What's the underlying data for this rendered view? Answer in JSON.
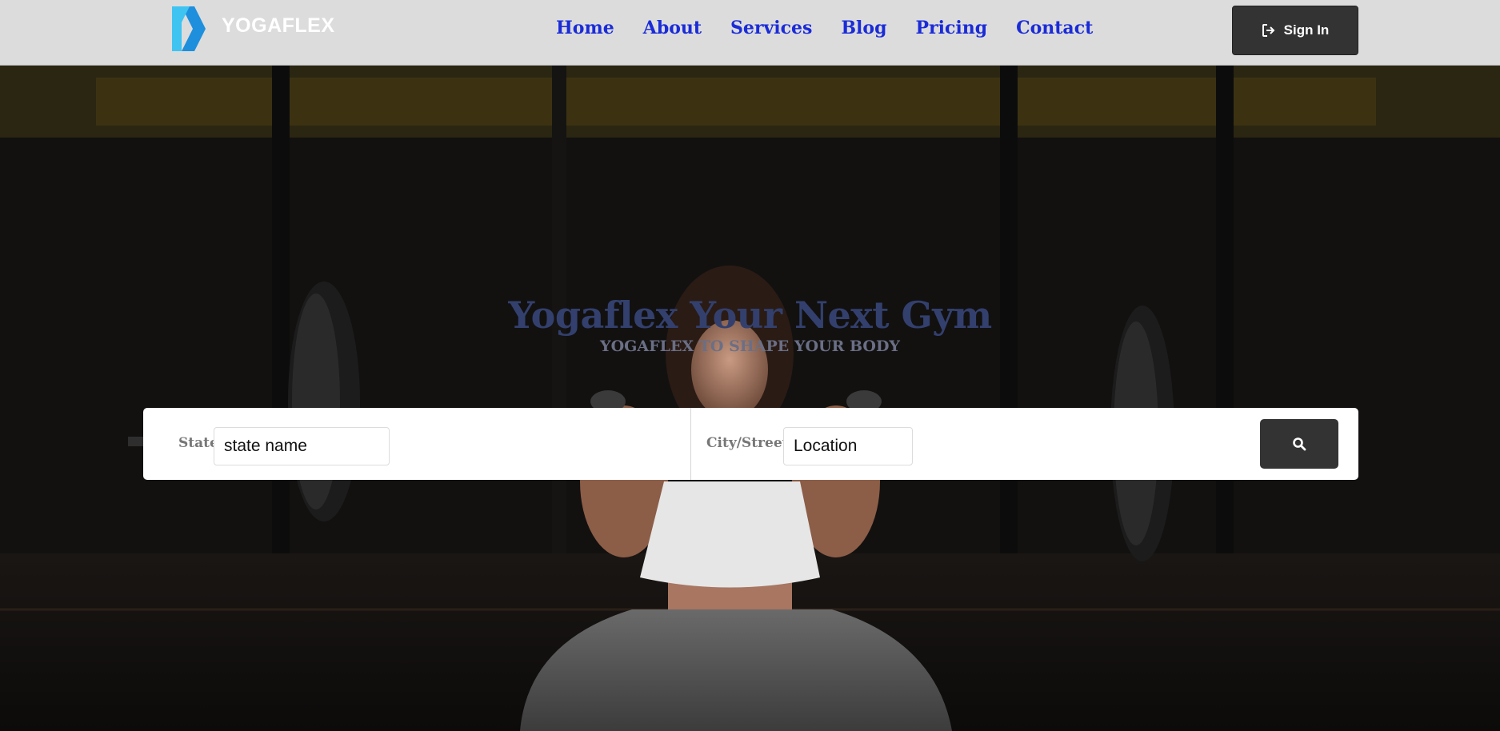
{
  "brand": {
    "name": "YOGAFLEX",
    "icon": "yogaflex-logo-icon",
    "colors": {
      "primary": "#3fc4f2",
      "secondary": "#1e8fdc"
    }
  },
  "nav": {
    "items": [
      {
        "label": "Home"
      },
      {
        "label": "About"
      },
      {
        "label": "Services"
      },
      {
        "label": "Blog"
      },
      {
        "label": "Pricing"
      },
      {
        "label": "Contact"
      }
    ],
    "link_color": "#1a2bd8"
  },
  "signin": {
    "label": "Sign In",
    "icon": "sign-in-icon"
  },
  "hero": {
    "title": "Yogaflex Your Next Gym",
    "subtitle": "YOGAFLEX TO SHAPE YOUR BODY",
    "background_image": "woman-lifting-barbell-photo"
  },
  "search": {
    "state_label": "State",
    "state_placeholder": "state name",
    "city_label": "City/Street",
    "city_placeholder": "Location",
    "button_icon": "search-icon"
  }
}
